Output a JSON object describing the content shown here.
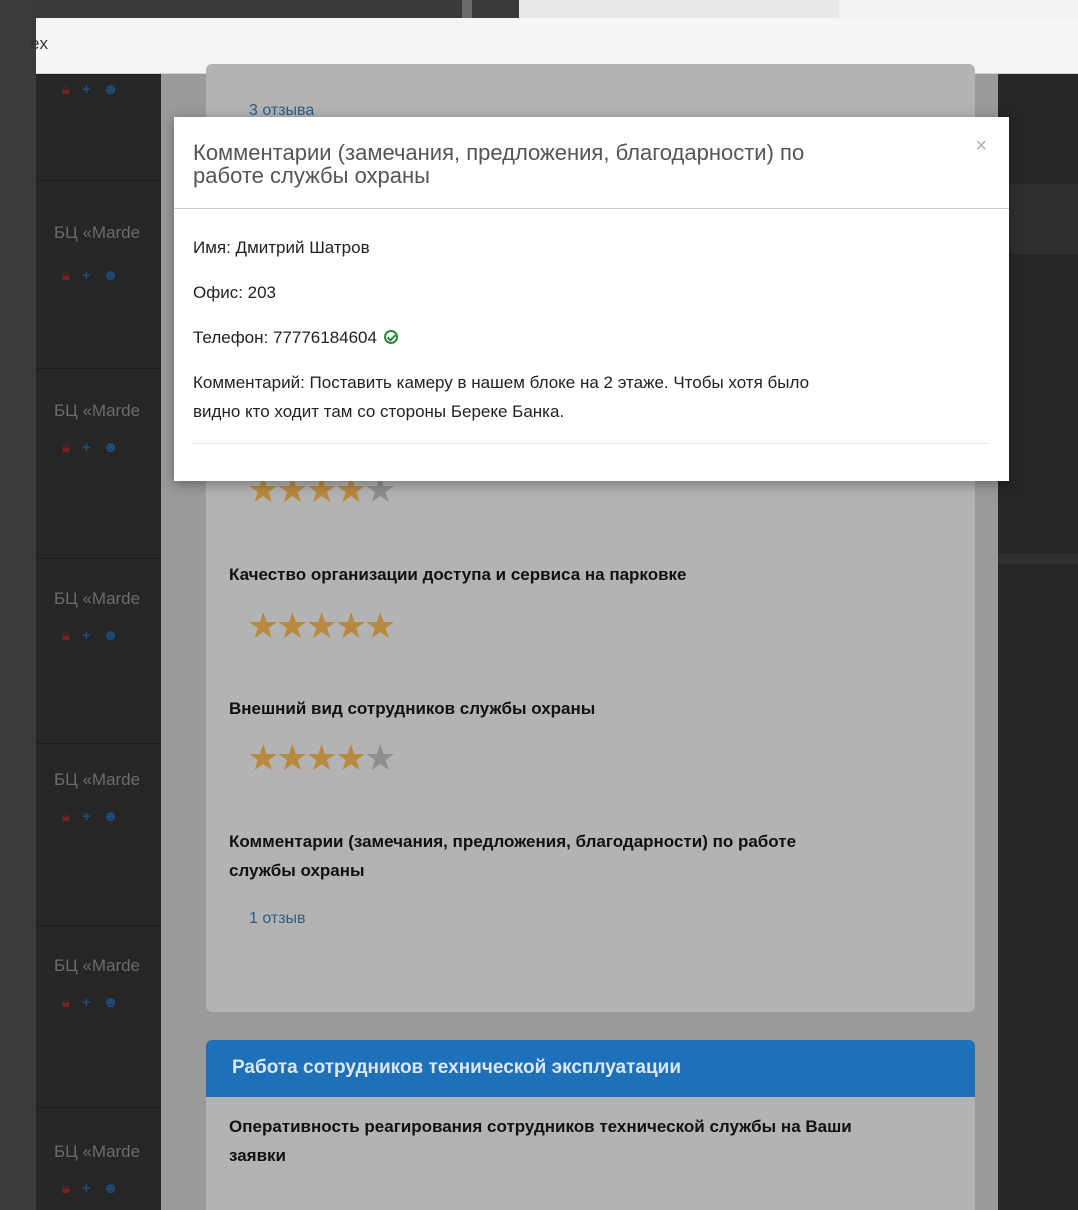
{
  "browser": {
    "address_fragment": "ex"
  },
  "background_list": {
    "items": [
      {
        "name": "БЦ «Marde"
      },
      {
        "name": "БЦ «Marde"
      },
      {
        "name": "БЦ «Marde"
      },
      {
        "name": "БЦ «Marde"
      },
      {
        "name": "БЦ «Marde"
      },
      {
        "name": "БЦ «Marde"
      }
    ],
    "icons": [
      "lock-icon",
      "plus-icon",
      "users-icon"
    ]
  },
  "survey": {
    "top_link": "3 отзыва",
    "questions": [
      {
        "title": "",
        "rating": 4,
        "max": 5
      },
      {
        "title": "Качество организации доступа и сервиса на парковке",
        "rating": 4.7,
        "max": 5
      },
      {
        "title": "Внешний вид сотрудников службы охраны",
        "rating": 4.5,
        "max": 5
      }
    ],
    "comments_question": {
      "title_line1": "Комментарии (замечания, предложения, благодарности) по работе",
      "title_line2": "службы охраны",
      "link": "1 отзыв"
    },
    "section2": {
      "header": "Работа сотрудников технической эксплуатации",
      "question_line1": "Оперативность реагирования сотрудников технической службы на Ваши",
      "question_line2": "заявки"
    }
  },
  "modal": {
    "title_line1": "Комментарии (замечания, предложения, благодарности) по",
    "title_line2": "работе службы охраны",
    "close_label": "×",
    "name": "Имя: Дмитрий Шатров",
    "office": "Офис: 203",
    "phone": "Телефон: 77776184604",
    "phone_verified_icon": "check-circle-icon",
    "comment_line1": "Комментарий: Поставить камеру в нашем блоке на 2 этаже. Чтобы хотя было",
    "comment_line2": "видно кто ходит там со стороны Береке Банка."
  },
  "colors": {
    "accent_blue": "#1e71b8",
    "star": "#b8893e",
    "verified_green": "#2c8a3a"
  }
}
